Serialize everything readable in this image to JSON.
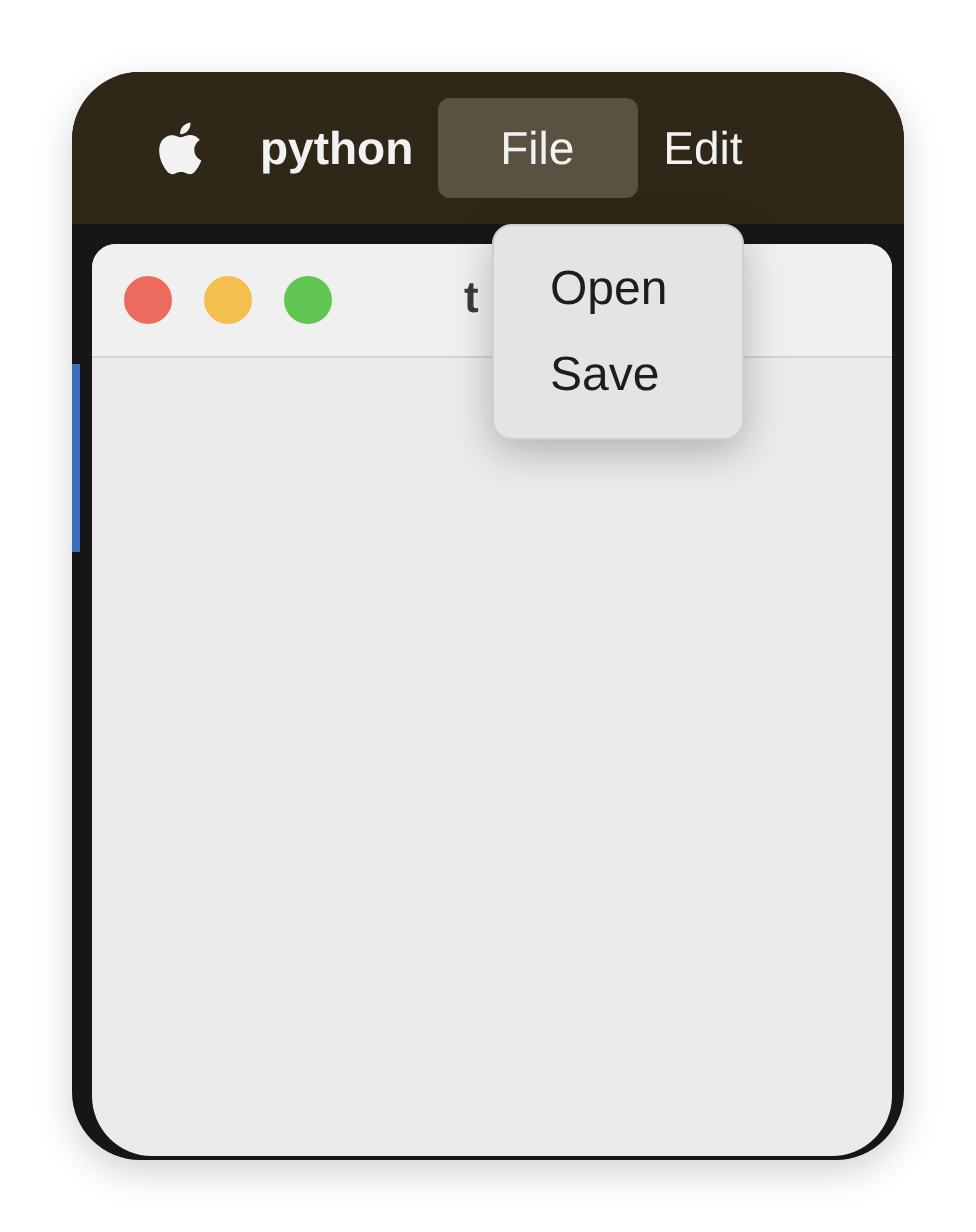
{
  "menu_bar": {
    "app_name": "python",
    "menus": [
      {
        "label": "File",
        "selected": true
      },
      {
        "label": "Edit",
        "selected": false
      }
    ]
  },
  "dropdown": {
    "items": [
      {
        "label": "Open"
      },
      {
        "label": "Save"
      }
    ]
  },
  "window": {
    "title": "t",
    "controls": [
      {
        "kind": "close"
      },
      {
        "kind": "minimize"
      },
      {
        "kind": "zoom"
      }
    ]
  }
}
